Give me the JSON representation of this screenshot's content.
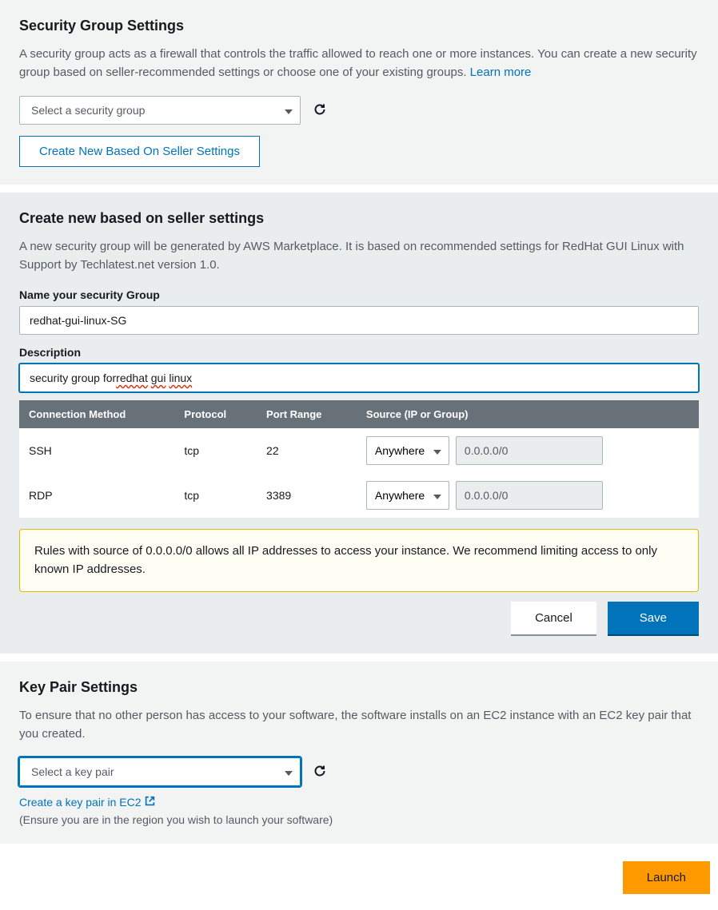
{
  "security_group_settings": {
    "title": "Security Group Settings",
    "description": "A security group acts as a firewall that controls the traffic allowed to reach one or more instances. You can create a new security group based on seller-recommended settings or choose one of your existing groups. ",
    "learn_more_label": "Learn more",
    "select_placeholder": "Select a security group",
    "create_new_button": "Create New Based On Seller Settings"
  },
  "create_new_panel": {
    "title": "Create new based on seller settings",
    "description": "A new security group will be generated by AWS Marketplace. It is based on recommended settings for RedHat GUI Linux with Support by Techlatest.net version 1.0.",
    "name_label": "Name your security Group",
    "name_value": "redhat-gui-linux-SG",
    "desc_label": "Description",
    "desc_prefix": "security group for ",
    "desc_word1": "redhat",
    "desc_word2": "gui",
    "desc_word3": "linux",
    "table": {
      "headers": {
        "connection": "Connection Method",
        "protocol": "Protocol",
        "port": "Port Range",
        "source": "Source (IP or Group)"
      },
      "rows": [
        {
          "method": "SSH",
          "protocol": "tcp",
          "port": "22",
          "source_type": "Anywhere",
          "source_ip": "0.0.0.0/0"
        },
        {
          "method": "RDP",
          "protocol": "tcp",
          "port": "3389",
          "source_type": "Anywhere",
          "source_ip": "0.0.0.0/0"
        }
      ]
    },
    "warning": "Rules with source of 0.0.0.0/0 allows all IP addresses to access your instance. We recommend limiting access to only known IP addresses.",
    "cancel_label": "Cancel",
    "save_label": "Save"
  },
  "key_pair_settings": {
    "title": "Key Pair Settings",
    "description": "To ensure that no other person has access to your software, the software installs on an EC2 instance with an EC2 key pair that you created.",
    "select_placeholder": "Select a key pair",
    "create_link_label": "Create a key pair in EC2",
    "region_note": "(Ensure you are in the region you wish to launch your software)"
  },
  "launch_label": "Launch"
}
